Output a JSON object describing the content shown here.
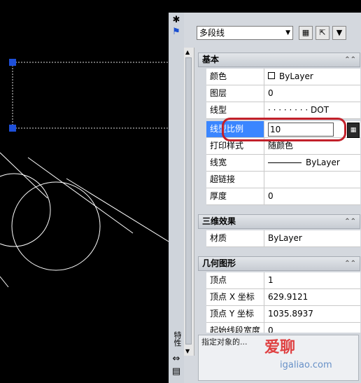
{
  "palette": {
    "title": "特性",
    "object_type": "多段线",
    "sections": {
      "basic": "基本",
      "three_d": "三维效果",
      "geometry": "几何图形"
    },
    "basic_rows": [
      {
        "key": "颜色",
        "value": "ByLayer"
      },
      {
        "key": "图层",
        "value": "0"
      },
      {
        "key": "线型",
        "value": "· · · · · · · · DOT"
      },
      {
        "key": "线型比例",
        "value": "10"
      },
      {
        "key": "打印样式",
        "value": "随颜色"
      },
      {
        "key": "线宽",
        "value": "ByLayer"
      },
      {
        "key": "超链接",
        "value": ""
      },
      {
        "key": "厚度",
        "value": "0"
      }
    ],
    "three_d_rows": [
      {
        "key": "材质",
        "value": "ByLayer"
      }
    ],
    "geometry_rows": [
      {
        "key": "顶点",
        "value": "1"
      },
      {
        "key": "顶点 X 坐标",
        "value": "629.9121"
      },
      {
        "key": "顶点 Y 坐标",
        "value": "1035.8937"
      },
      {
        "key": "起始线段宽度",
        "value": "0"
      }
    ],
    "description": "指定对象的..."
  },
  "watermark": {
    "brand": "爱聊",
    "url": "igaliao.com"
  },
  "icons": {
    "pin": "pin-icon",
    "autohide": "autohide-icon",
    "quick_select": "quick-select-icon",
    "select_objects": "select-objects-icon",
    "toggle_pickadd": "pickadd-icon",
    "calculator": "calculator-icon"
  },
  "colors": {
    "selection_blue": "#3a86ff",
    "highlight_red": "#c2202a",
    "grip_blue": "#1e4fd8"
  }
}
